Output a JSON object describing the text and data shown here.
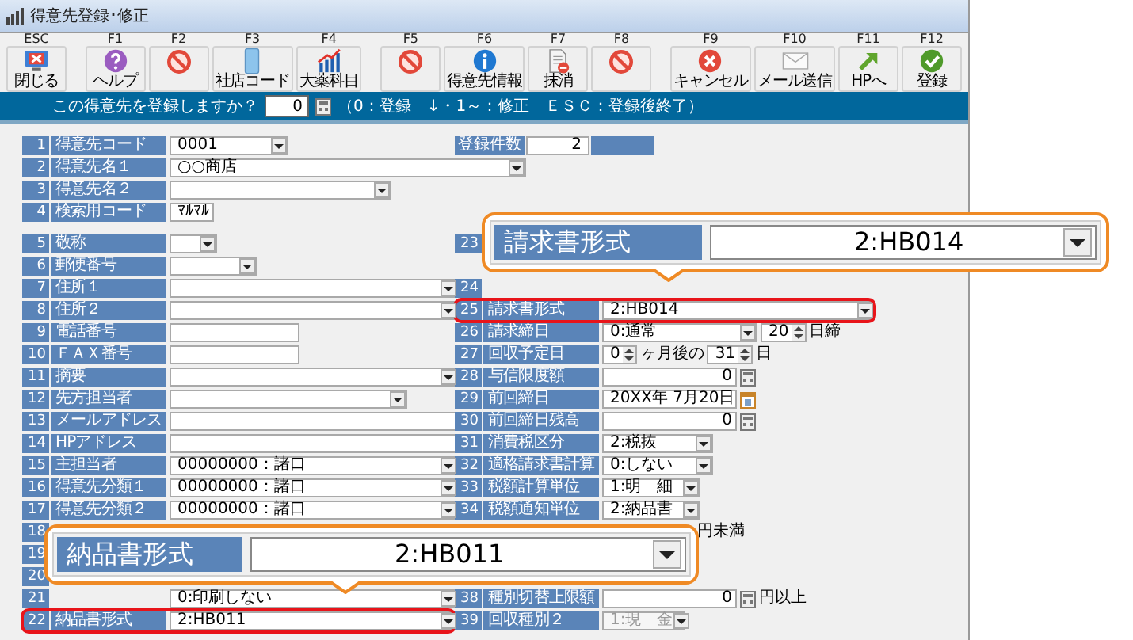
{
  "window": {
    "title": "得意先登録･修正"
  },
  "toolbar": [
    {
      "key": "ESC",
      "label": "閉じる",
      "kind": "close"
    },
    {
      "key": "F1",
      "label": "ヘルプ",
      "kind": "help"
    },
    {
      "key": "F2",
      "kind": "blocked"
    },
    {
      "key": "F3",
      "label": "社店コード",
      "kind": "card"
    },
    {
      "key": "F4",
      "label": "大薬科目",
      "kind": "chart"
    },
    {
      "key": "F5",
      "kind": "blocked"
    },
    {
      "key": "F6",
      "label": "得意先情報",
      "kind": "info"
    },
    {
      "key": "F7",
      "label": "抹消",
      "kind": "erase"
    },
    {
      "key": "F8",
      "kind": "blocked"
    },
    {
      "key": "F9",
      "label": "キャンセル",
      "kind": "cancel"
    },
    {
      "key": "F10",
      "label": "メール送信",
      "kind": "mail"
    },
    {
      "key": "F11",
      "label": "HPへ",
      "kind": "web"
    },
    {
      "key": "F12",
      "label": "登録",
      "kind": "ok"
    }
  ],
  "prompt": {
    "question": "この得意先を登録しますか？",
    "value": "0",
    "hint": "（0：登録　↓・1～：修正　ＥＳＣ：登録後終了）"
  },
  "count": {
    "label": "登録件数",
    "value": "2"
  },
  "left_rows": [
    {
      "no": "1",
      "label": "得意先コード",
      "highlighted": false,
      "parts": [
        {
          "kind": "combo",
          "value": "0001"
        }
      ]
    },
    {
      "no": "2",
      "label": "得意先名１",
      "highlighted": false,
      "parts": [
        {
          "kind": "combo",
          "value": "○○商店"
        }
      ]
    },
    {
      "no": "3",
      "label": "得意先名２",
      "highlighted": false,
      "parts": [
        {
          "kind": "combo"
        }
      ]
    },
    {
      "no": "4",
      "label": "検索用コード",
      "highlighted": false,
      "parts": [
        {
          "kind": "text",
          "value": "ﾏﾙﾏﾙ"
        }
      ]
    },
    {
      "no": "5",
      "label": "敬称",
      "highlighted": false,
      "parts": [
        {
          "kind": "combo"
        }
      ]
    },
    {
      "no": "6",
      "label": "郵便番号",
      "highlighted": false,
      "parts": [
        {
          "kind": "combo"
        }
      ]
    },
    {
      "no": "7",
      "label": "住所１",
      "highlighted": false,
      "parts": [
        {
          "kind": "combo"
        }
      ]
    },
    {
      "no": "8",
      "label": "住所２",
      "highlighted": false,
      "parts": [
        {
          "kind": "combo"
        }
      ]
    },
    {
      "no": "9",
      "label": "電話番号",
      "highlighted": false,
      "parts": [
        {
          "kind": "text"
        }
      ]
    },
    {
      "no": "10",
      "label": "ＦＡＸ番号",
      "highlighted": false,
      "parts": [
        {
          "kind": "text"
        }
      ]
    },
    {
      "no": "11",
      "label": "摘要",
      "highlighted": false,
      "parts": [
        {
          "kind": "combo"
        }
      ]
    },
    {
      "no": "12",
      "label": "先方担当者",
      "highlighted": false,
      "parts": [
        {
          "kind": "combo"
        }
      ]
    },
    {
      "no": "13",
      "label": "メールアドレス",
      "highlighted": false,
      "parts": [
        {
          "kind": "text"
        }
      ]
    },
    {
      "no": "14",
      "label": "HPアドレス",
      "highlighted": false,
      "parts": [
        {
          "kind": "text"
        }
      ]
    },
    {
      "no": "15",
      "label": "主担当者",
      "highlighted": false,
      "parts": [
        {
          "kind": "combo",
          "value": "00000000：諸口"
        }
      ]
    },
    {
      "no": "16",
      "label": "得意先分類１",
      "highlighted": false,
      "parts": [
        {
          "kind": "combo",
          "value": "00000000：諸口"
        }
      ]
    },
    {
      "no": "17",
      "label": "得意先分類２",
      "highlighted": false,
      "parts": [
        {
          "kind": "combo",
          "value": "00000000：諸口"
        }
      ]
    },
    {
      "no": "18",
      "highlighted": false
    },
    {
      "no": "19",
      "highlighted": false
    },
    {
      "no": "20",
      "highlighted": false
    },
    {
      "no": "21",
      "highlighted": false,
      "parts": [
        {
          "kind": "combo",
          "value": "0:印刷しない"
        }
      ]
    },
    {
      "no": "22",
      "label": "納品書形式",
      "highlighted": true,
      "parts": [
        {
          "kind": "combo",
          "value": "2:HB011"
        }
      ]
    }
  ],
  "right_rows": [
    {
      "no": "23",
      "highlighted": false
    },
    {
      "no": "24",
      "highlighted": false
    },
    {
      "no": "25",
      "label": "請求書形式",
      "highlighted": true,
      "parts": [
        {
          "kind": "combo",
          "value": "2:HB014"
        }
      ]
    },
    {
      "no": "26",
      "label": "請求締日",
      "highlighted": false,
      "parts": [
        {
          "kind": "combo",
          "value": "0:通常"
        },
        {
          "kind": "spin",
          "value": "20"
        },
        {
          "kind": "plain",
          "value": "日締"
        }
      ]
    },
    {
      "no": "27",
      "label": "回収予定日",
      "highlighted": false,
      "parts": [
        {
          "kind": "spin",
          "value": "0"
        },
        {
          "kind": "plain",
          "value": "ヶ月後の"
        },
        {
          "kind": "spin",
          "value": "31"
        },
        {
          "kind": "plain",
          "value": "日"
        }
      ]
    },
    {
      "no": "28",
      "label": "与信限度額",
      "highlighted": false,
      "parts": [
        {
          "kind": "number",
          "value": "0"
        }
      ]
    },
    {
      "no": "29",
      "label": "前回締日",
      "highlighted": false,
      "parts": [
        {
          "kind": "date",
          "value": "20XX年 7月20日"
        }
      ]
    },
    {
      "no": "30",
      "label": "前回締日残高",
      "highlighted": false,
      "parts": [
        {
          "kind": "number",
          "value": "0"
        }
      ]
    },
    {
      "no": "31",
      "label": "消費税区分",
      "highlighted": false,
      "parts": [
        {
          "kind": "combo",
          "value": "2:税抜"
        }
      ]
    },
    {
      "no": "32",
      "label": "適格請求書計算",
      "highlighted": false,
      "parts": [
        {
          "kind": "combo",
          "value": "0:しない"
        }
      ]
    },
    {
      "no": "33",
      "label": "税額計算単位",
      "highlighted": false,
      "parts": [
        {
          "kind": "combo",
          "value": "1:明　細"
        }
      ]
    },
    {
      "no": "34",
      "label": "税額通知単位",
      "highlighted": false,
      "parts": [
        {
          "kind": "combo",
          "value": "2:納品書"
        }
      ]
    },
    {
      "highlighted": false,
      "parts": [
        {
          "kind": "plain",
          "value": "円未満"
        }
      ]
    },
    {
      "no": "38",
      "label": "種別切替上限額",
      "highlighted": false,
      "parts": [
        {
          "kind": "number",
          "value": "0"
        },
        {
          "kind": "plain",
          "value": "円以上"
        }
      ]
    },
    {
      "no": "39",
      "label": "回収種別２",
      "highlighted": false,
      "parts": [
        {
          "kind": "combo",
          "value": "1:現　金",
          "disabled": true
        }
      ]
    }
  ],
  "callouts": [
    {
      "label": "請求書形式",
      "value": "2:HB014"
    },
    {
      "label": "納品書形式",
      "value": "2:HB011"
    }
  ]
}
